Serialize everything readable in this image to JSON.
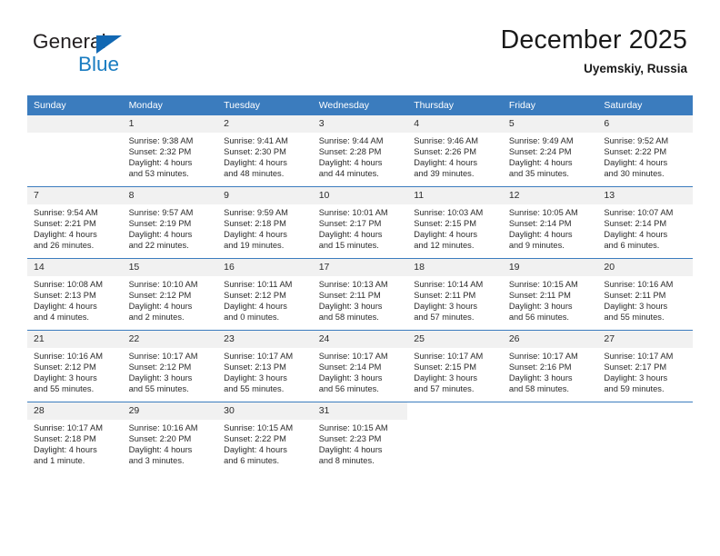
{
  "brand": {
    "name_part1": "General",
    "name_part2": "Blue",
    "triangle_icon": "triangle-icon",
    "accent_color": "#1a7cc1",
    "header_color": "#3b7cbe"
  },
  "header": {
    "title": "December 2025",
    "subtitle": "Uyemskiy, Russia"
  },
  "calendar": {
    "weekday_headers": [
      "Sunday",
      "Monday",
      "Tuesday",
      "Wednesday",
      "Thursday",
      "Friday",
      "Saturday"
    ],
    "weeks": [
      [
        {
          "day": "",
          "sunrise": "",
          "sunset": "",
          "daylight1": "",
          "daylight2": ""
        },
        {
          "day": "1",
          "sunrise": "Sunrise: 9:38 AM",
          "sunset": "Sunset: 2:32 PM",
          "daylight1": "Daylight: 4 hours",
          "daylight2": "and 53 minutes."
        },
        {
          "day": "2",
          "sunrise": "Sunrise: 9:41 AM",
          "sunset": "Sunset: 2:30 PM",
          "daylight1": "Daylight: 4 hours",
          "daylight2": "and 48 minutes."
        },
        {
          "day": "3",
          "sunrise": "Sunrise: 9:44 AM",
          "sunset": "Sunset: 2:28 PM",
          "daylight1": "Daylight: 4 hours",
          "daylight2": "and 44 minutes."
        },
        {
          "day": "4",
          "sunrise": "Sunrise: 9:46 AM",
          "sunset": "Sunset: 2:26 PM",
          "daylight1": "Daylight: 4 hours",
          "daylight2": "and 39 minutes."
        },
        {
          "day": "5",
          "sunrise": "Sunrise: 9:49 AM",
          "sunset": "Sunset: 2:24 PM",
          "daylight1": "Daylight: 4 hours",
          "daylight2": "and 35 minutes."
        },
        {
          "day": "6",
          "sunrise": "Sunrise: 9:52 AM",
          "sunset": "Sunset: 2:22 PM",
          "daylight1": "Daylight: 4 hours",
          "daylight2": "and 30 minutes."
        }
      ],
      [
        {
          "day": "7",
          "sunrise": "Sunrise: 9:54 AM",
          "sunset": "Sunset: 2:21 PM",
          "daylight1": "Daylight: 4 hours",
          "daylight2": "and 26 minutes."
        },
        {
          "day": "8",
          "sunrise": "Sunrise: 9:57 AM",
          "sunset": "Sunset: 2:19 PM",
          "daylight1": "Daylight: 4 hours",
          "daylight2": "and 22 minutes."
        },
        {
          "day": "9",
          "sunrise": "Sunrise: 9:59 AM",
          "sunset": "Sunset: 2:18 PM",
          "daylight1": "Daylight: 4 hours",
          "daylight2": "and 19 minutes."
        },
        {
          "day": "10",
          "sunrise": "Sunrise: 10:01 AM",
          "sunset": "Sunset: 2:17 PM",
          "daylight1": "Daylight: 4 hours",
          "daylight2": "and 15 minutes."
        },
        {
          "day": "11",
          "sunrise": "Sunrise: 10:03 AM",
          "sunset": "Sunset: 2:15 PM",
          "daylight1": "Daylight: 4 hours",
          "daylight2": "and 12 minutes."
        },
        {
          "day": "12",
          "sunrise": "Sunrise: 10:05 AM",
          "sunset": "Sunset: 2:14 PM",
          "daylight1": "Daylight: 4 hours",
          "daylight2": "and 9 minutes."
        },
        {
          "day": "13",
          "sunrise": "Sunrise: 10:07 AM",
          "sunset": "Sunset: 2:14 PM",
          "daylight1": "Daylight: 4 hours",
          "daylight2": "and 6 minutes."
        }
      ],
      [
        {
          "day": "14",
          "sunrise": "Sunrise: 10:08 AM",
          "sunset": "Sunset: 2:13 PM",
          "daylight1": "Daylight: 4 hours",
          "daylight2": "and 4 minutes."
        },
        {
          "day": "15",
          "sunrise": "Sunrise: 10:10 AM",
          "sunset": "Sunset: 2:12 PM",
          "daylight1": "Daylight: 4 hours",
          "daylight2": "and 2 minutes."
        },
        {
          "day": "16",
          "sunrise": "Sunrise: 10:11 AM",
          "sunset": "Sunset: 2:12 PM",
          "daylight1": "Daylight: 4 hours",
          "daylight2": "and 0 minutes."
        },
        {
          "day": "17",
          "sunrise": "Sunrise: 10:13 AM",
          "sunset": "Sunset: 2:11 PM",
          "daylight1": "Daylight: 3 hours",
          "daylight2": "and 58 minutes."
        },
        {
          "day": "18",
          "sunrise": "Sunrise: 10:14 AM",
          "sunset": "Sunset: 2:11 PM",
          "daylight1": "Daylight: 3 hours",
          "daylight2": "and 57 minutes."
        },
        {
          "day": "19",
          "sunrise": "Sunrise: 10:15 AM",
          "sunset": "Sunset: 2:11 PM",
          "daylight1": "Daylight: 3 hours",
          "daylight2": "and 56 minutes."
        },
        {
          "day": "20",
          "sunrise": "Sunrise: 10:16 AM",
          "sunset": "Sunset: 2:11 PM",
          "daylight1": "Daylight: 3 hours",
          "daylight2": "and 55 minutes."
        }
      ],
      [
        {
          "day": "21",
          "sunrise": "Sunrise: 10:16 AM",
          "sunset": "Sunset: 2:12 PM",
          "daylight1": "Daylight: 3 hours",
          "daylight2": "and 55 minutes."
        },
        {
          "day": "22",
          "sunrise": "Sunrise: 10:17 AM",
          "sunset": "Sunset: 2:12 PM",
          "daylight1": "Daylight: 3 hours",
          "daylight2": "and 55 minutes."
        },
        {
          "day": "23",
          "sunrise": "Sunrise: 10:17 AM",
          "sunset": "Sunset: 2:13 PM",
          "daylight1": "Daylight: 3 hours",
          "daylight2": "and 55 minutes."
        },
        {
          "day": "24",
          "sunrise": "Sunrise: 10:17 AM",
          "sunset": "Sunset: 2:14 PM",
          "daylight1": "Daylight: 3 hours",
          "daylight2": "and 56 minutes."
        },
        {
          "day": "25",
          "sunrise": "Sunrise: 10:17 AM",
          "sunset": "Sunset: 2:15 PM",
          "daylight1": "Daylight: 3 hours",
          "daylight2": "and 57 minutes."
        },
        {
          "day": "26",
          "sunrise": "Sunrise: 10:17 AM",
          "sunset": "Sunset: 2:16 PM",
          "daylight1": "Daylight: 3 hours",
          "daylight2": "and 58 minutes."
        },
        {
          "day": "27",
          "sunrise": "Sunrise: 10:17 AM",
          "sunset": "Sunset: 2:17 PM",
          "daylight1": "Daylight: 3 hours",
          "daylight2": "and 59 minutes."
        }
      ],
      [
        {
          "day": "28",
          "sunrise": "Sunrise: 10:17 AM",
          "sunset": "Sunset: 2:18 PM",
          "daylight1": "Daylight: 4 hours",
          "daylight2": "and 1 minute."
        },
        {
          "day": "29",
          "sunrise": "Sunrise: 10:16 AM",
          "sunset": "Sunset: 2:20 PM",
          "daylight1": "Daylight: 4 hours",
          "daylight2": "and 3 minutes."
        },
        {
          "day": "30",
          "sunrise": "Sunrise: 10:15 AM",
          "sunset": "Sunset: 2:22 PM",
          "daylight1": "Daylight: 4 hours",
          "daylight2": "and 6 minutes."
        },
        {
          "day": "31",
          "sunrise": "Sunrise: 10:15 AM",
          "sunset": "Sunset: 2:23 PM",
          "daylight1": "Daylight: 4 hours",
          "daylight2": "and 8 minutes."
        },
        {
          "day": "",
          "sunrise": "",
          "sunset": "",
          "daylight1": "",
          "daylight2": ""
        },
        {
          "day": "",
          "sunrise": "",
          "sunset": "",
          "daylight1": "",
          "daylight2": ""
        },
        {
          "day": "",
          "sunrise": "",
          "sunset": "",
          "daylight1": "",
          "daylight2": ""
        }
      ]
    ]
  }
}
